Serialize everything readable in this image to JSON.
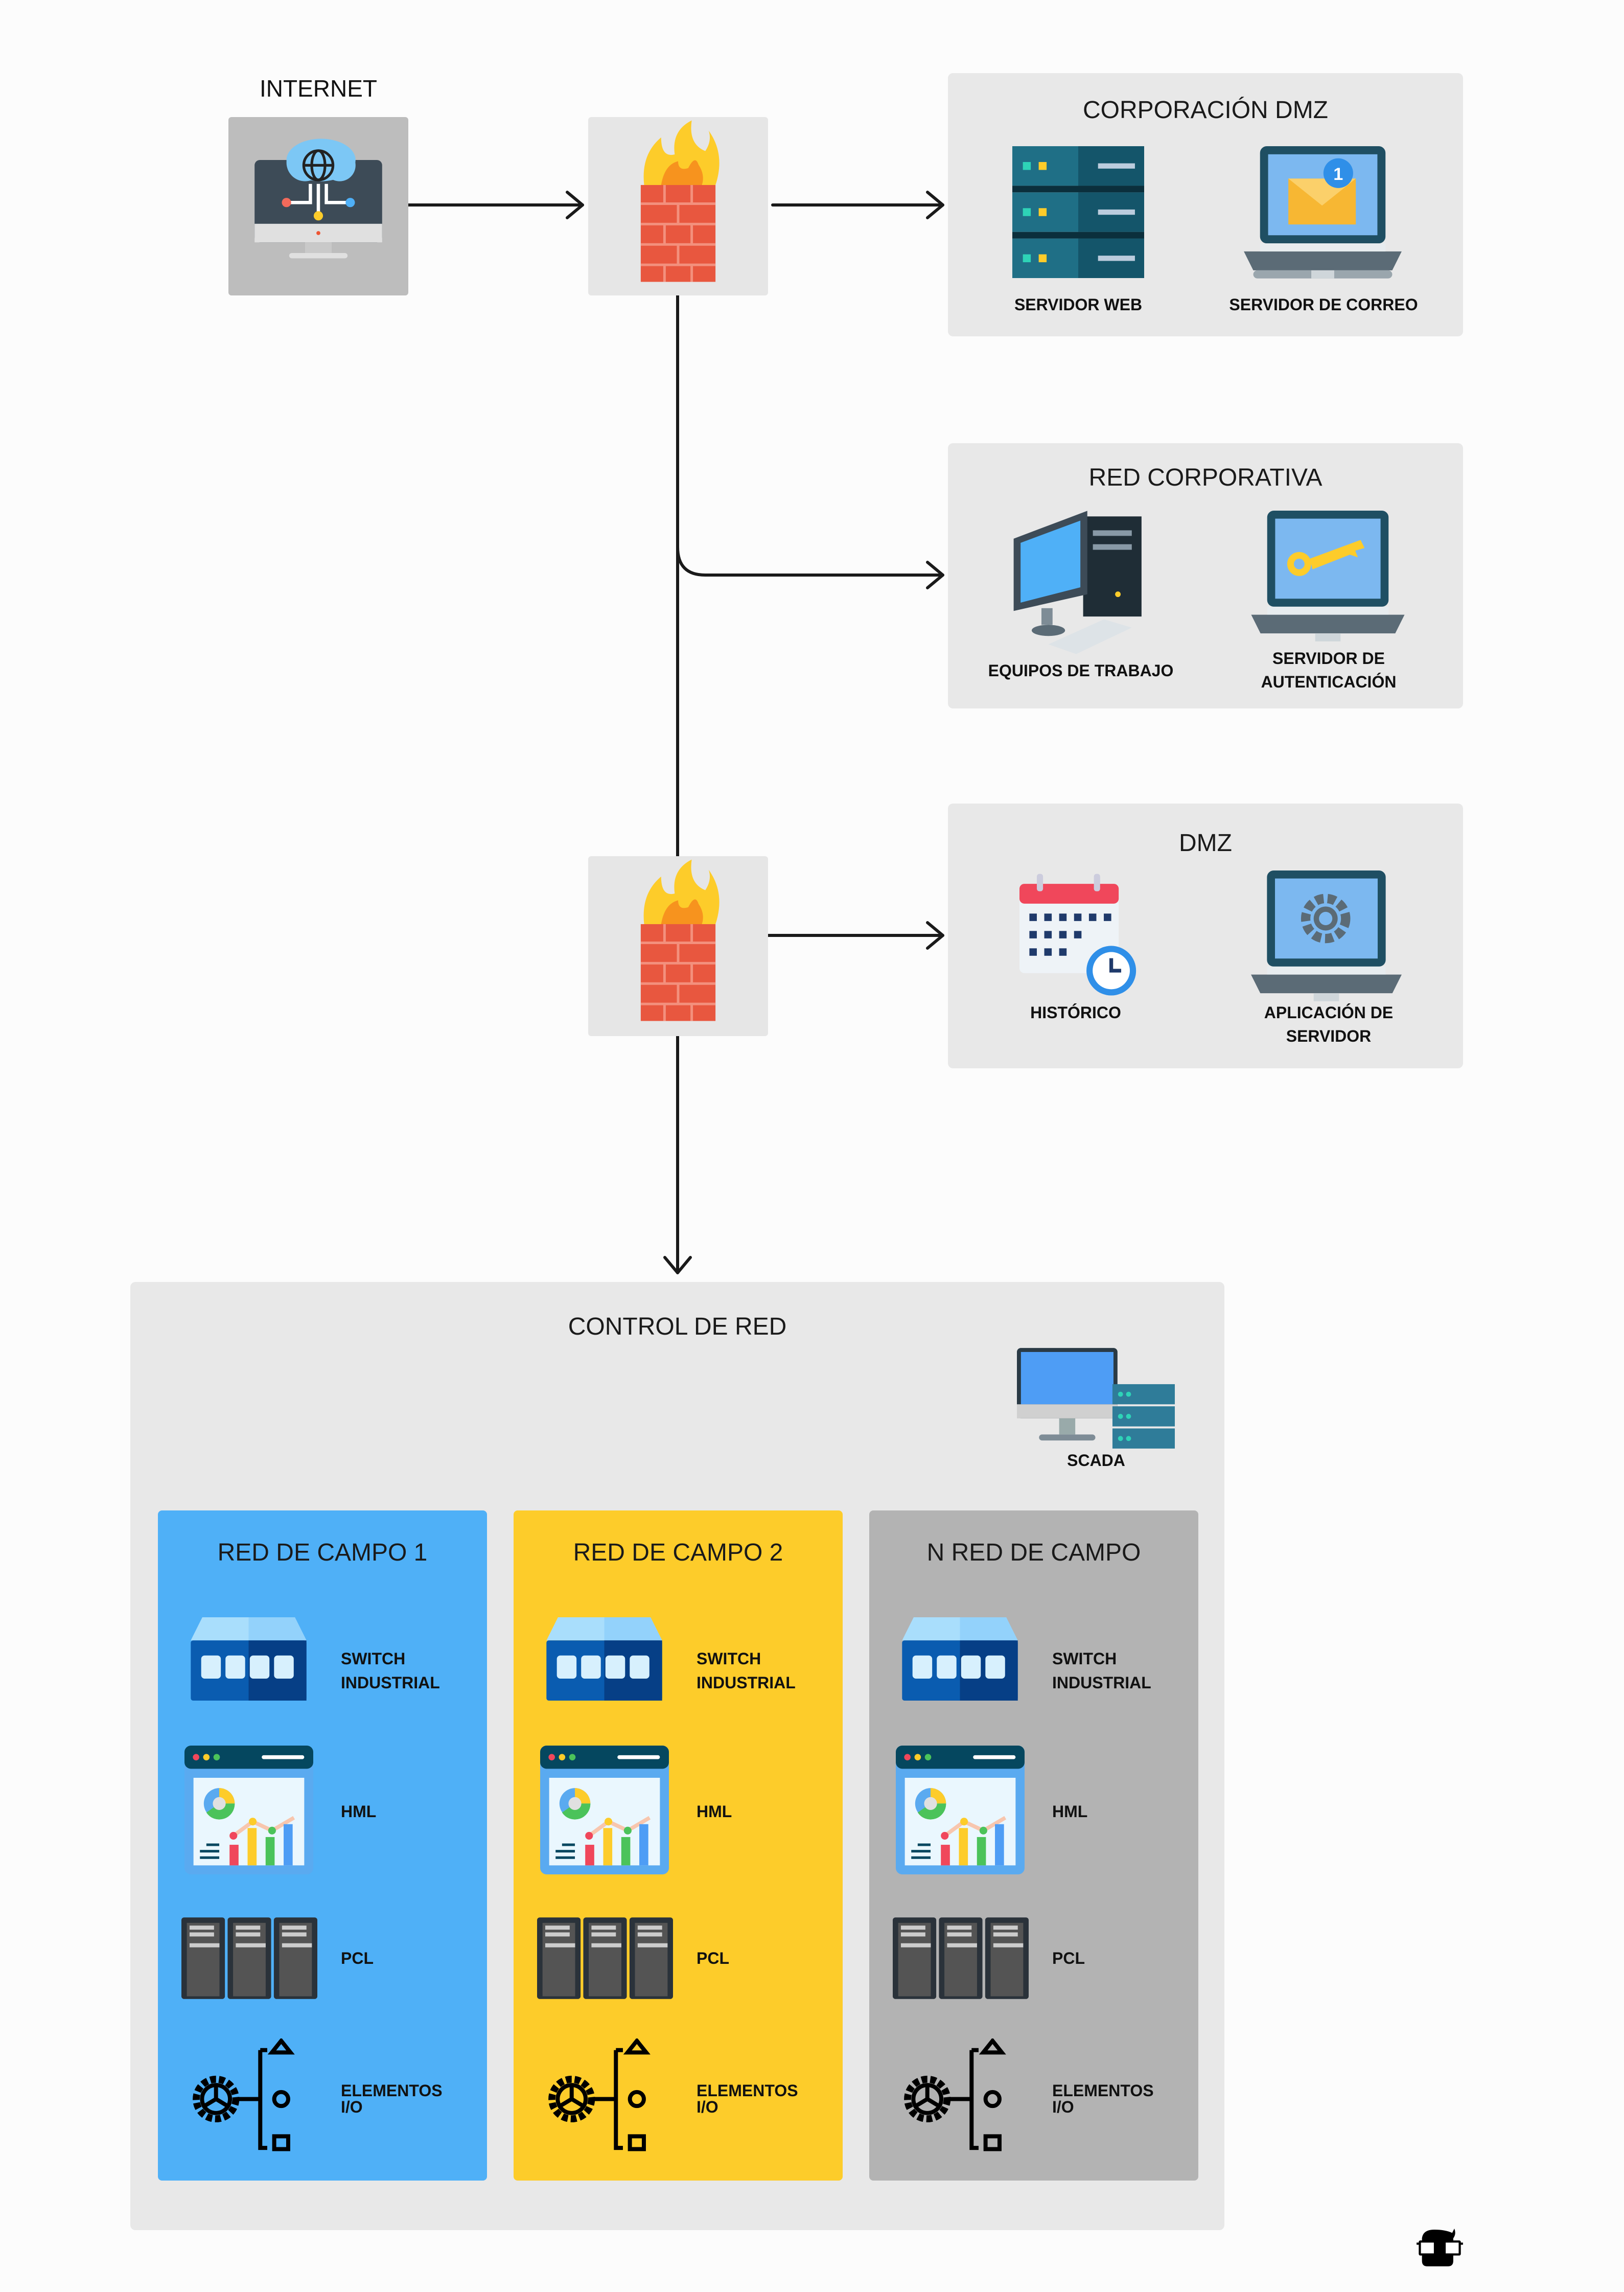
{
  "internet": {
    "label": "INTERNET"
  },
  "corp_dmz": {
    "title": "CORPORACIÓN DMZ",
    "items": [
      "SERVIDOR WEB",
      "SERVIDOR DE CORREO"
    ],
    "mail_badge": "1"
  },
  "red_corporativa": {
    "title": "RED CORPORATIVA",
    "items": [
      "EQUIPOS DE TRABAJO",
      "SERVIDOR DE",
      "AUTENTICACIÓN"
    ]
  },
  "dmz": {
    "title": "DMZ",
    "items": [
      "HISTÓRICO",
      "APLICACIÓN DE",
      "SERVIDOR"
    ]
  },
  "control": {
    "title": "CONTROL DE RED",
    "scada": "SCADA"
  },
  "fields": [
    {
      "title": "RED DE CAMPO 1",
      "color": "#4fb0f7"
    },
    {
      "title": "RED DE CAMPO 2",
      "color": "#fdcc2a"
    },
    {
      "title": "N RED DE CAMPO",
      "color": "#b3b3b3"
    }
  ],
  "field_items": {
    "switch1": "SWITCH",
    "switch2": "INDUSTRIAL",
    "hml": "HML",
    "pcl": "PCL",
    "io1": "ELEMENTOS",
    "io2": "I/O"
  },
  "icons": [
    "internet-monitor-icon",
    "firewall-icon",
    "server-rack-icon",
    "mail-laptop-icon",
    "workstation-icon",
    "key-laptop-icon",
    "calendar-clock-icon",
    "gear-laptop-icon",
    "scada-icon",
    "switch-icon",
    "dashboard-icon",
    "plc-icon",
    "io-elements-icon",
    "logo-icon"
  ]
}
